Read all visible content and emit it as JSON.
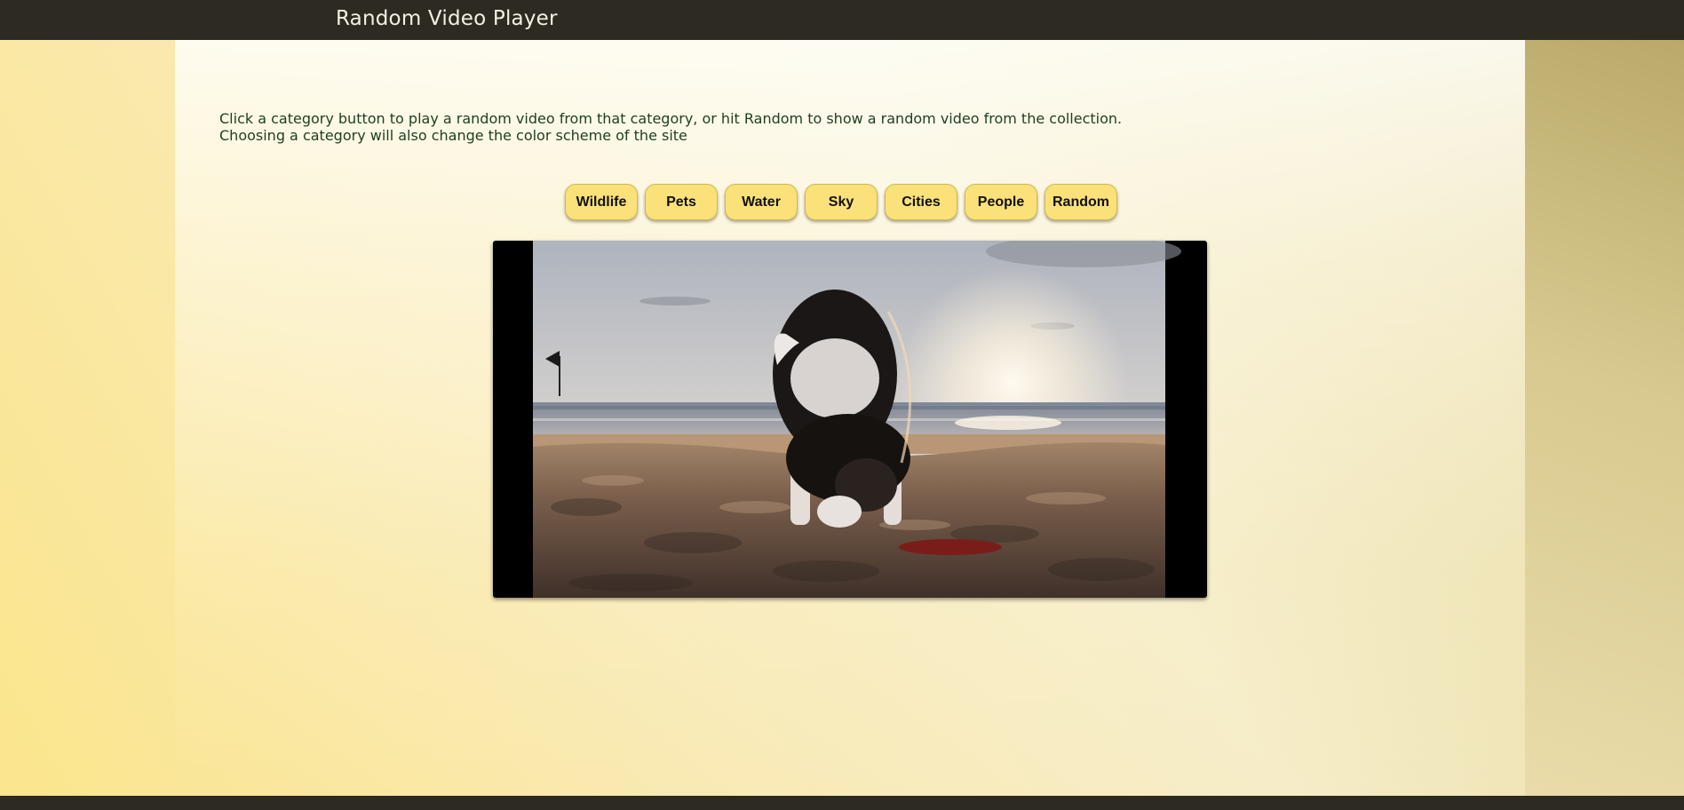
{
  "header": {
    "title": "Random Video Player"
  },
  "instructions": {
    "line1": "Click a category button to play a random video from that category, or hit Random to show a random video from the collection.",
    "line2": "Choosing a category will also change the color scheme of the site"
  },
  "categories": [
    {
      "label": "Wildlife"
    },
    {
      "label": "Pets"
    },
    {
      "label": "Water"
    },
    {
      "label": "Sky"
    },
    {
      "label": "Cities"
    },
    {
      "label": "People"
    },
    {
      "label": "Random"
    }
  ],
  "theme": {
    "bar_color": "#2c2a21",
    "button_color": "#fbe17a",
    "text_color": "#1f4020"
  },
  "video": {
    "subject": "puppy digging in sand on a beach at sunset"
  }
}
